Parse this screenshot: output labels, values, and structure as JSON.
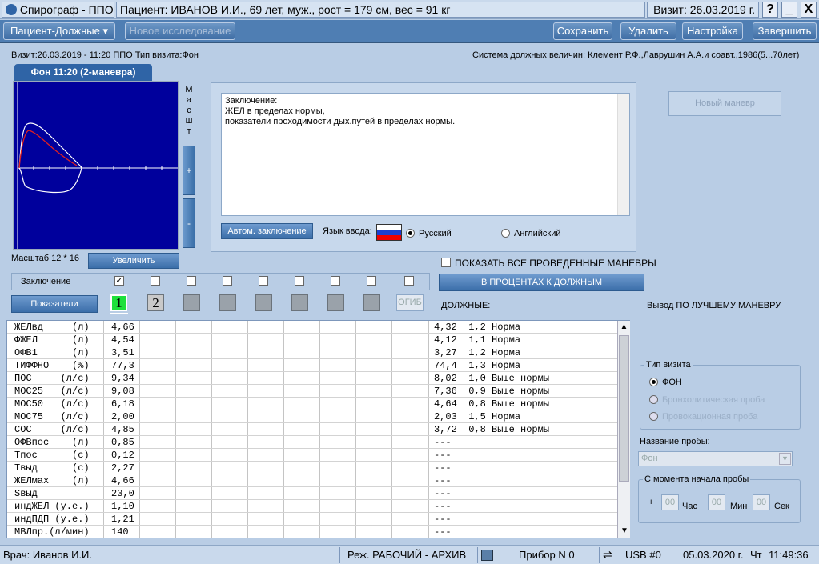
{
  "title_bar": {
    "app": "Спирограф - ППО",
    "patient": "Пациент: ИВАНОВ И.И., 69 лет, муж., рост = 179 см, вес = 91 кг",
    "visit": "Визит: 26.03.2019 г.",
    "help": "?",
    "minimize": "_",
    "close": "X"
  },
  "toolbar": {
    "dropdown": "Пациент-Должные",
    "new_study": "Новое исследование",
    "save": "Сохранить",
    "delete": "Удалить",
    "settings": "Настройка",
    "finish": "Завершить"
  },
  "visit_info": "Визит:26.03.2019 - 11:20 ППО Тип визита:Фон",
  "norm_system": "Система должных величин: Клемент Р.Ф.,Лаврушин А.А.и соавт.,1986(5...70лет)",
  "tab": "Фон 11:20 (2-маневра)",
  "scale_vertical": [
    "М",
    "а",
    "с",
    "ш",
    "т"
  ],
  "zoom_in": "+",
  "zoom_out": "-",
  "scale_label": "Масштаб 12 * 16",
  "enlarge_btn": "Увеличить",
  "conclusion_text": [
    "Заключение:",
    "ЖЕЛ в пределах нормы,",
    "показатели проходимости дых.путей в пределах нормы."
  ],
  "auto_conclusion_btn": "Автом. заключение",
  "input_lang_label": "Язык ввода:",
  "lang_ru": "Русский",
  "lang_en": "Английский",
  "new_maneuver_btn": "Новый маневр",
  "show_all_label": "ПОКАЗАТЬ ВСЕ ПРОВЕДЕННЫЕ МАНЕВРЫ",
  "percent_btn": "В ПРОЦЕНТАХ К ДОЛЖНЫМ",
  "conclusion_row_label": "Заключение",
  "indicators_btn": "Показатели",
  "maneuver_1": "1",
  "maneuver_2": "2",
  "ogib_btn": "ОГИБ",
  "due_label": "ДОЛЖНЫЕ:",
  "best_maneuver": "Вывод ПО ЛУЧШЕМУ МАНЕВРУ",
  "table_rows": [
    [
      "ЖЕЛвд     (л)",
      "4,66",
      "4,32  1,2 Норма"
    ],
    [
      "ФЖЕЛ      (л)",
      "4,54",
      "4,12  1,1 Норма"
    ],
    [
      "ОФВ1      (л)",
      "3,51",
      "3,27  1,2 Норма"
    ],
    [
      "ТИФФНО    (%)",
      "77,3",
      "74,4  1,3 Норма"
    ],
    [
      "ПОС     (л/с)",
      "9,34",
      "8,02  1,0 Выше нормы"
    ],
    [
      "МОС25   (л/с)",
      "9,08",
      "7,36  0,9 Выше нормы"
    ],
    [
      "МОС50   (л/с)",
      "6,18",
      "4,64  0,8 Выше нормы"
    ],
    [
      "МОС75   (л/с)",
      "2,00",
      "2,03  1,5 Норма"
    ],
    [
      "СОС     (л/с)",
      "4,85",
      "3,72  0,8 Выше нормы"
    ],
    [
      "ОФВпос    (л)",
      "0,85",
      "---"
    ],
    [
      "Tпос      (с)",
      "0,12",
      "---"
    ],
    [
      "Tвыд      (с)",
      "2,27",
      "---"
    ],
    [
      "ЖЕЛмах    (л)",
      "4,66",
      "---"
    ],
    [
      "Sвыд",
      "23,0",
      "---"
    ],
    [
      "индЖЕЛ (у.е.)",
      "1,10",
      "---"
    ],
    [
      "индПДП (у.е.)",
      "1,21",
      "---"
    ],
    [
      "МВЛпр.(л/мин)",
      "140",
      "---"
    ]
  ],
  "visit_type": {
    "title": "Тип визита",
    "opt1": "ФОН",
    "opt2": "Бронхолитическая проба",
    "opt3": "Провокационная проба"
  },
  "test_name_label": "Название пробы:",
  "test_name_value": "Фон",
  "since_start": {
    "title": "С момента начала пробы",
    "plus": "+",
    "h": "00",
    "h_lbl": "Час",
    "m": "00",
    "m_lbl": "Мин",
    "s": "00",
    "s_lbl": "Сек"
  },
  "status": {
    "doctor": "Врач: Иванов И.И.",
    "mode": "Реж. РАБОЧИЙ - АРХИВ",
    "device": "Прибор N 0",
    "usb": "USB #0",
    "date": "05.03.2020 г.",
    "dow": "Чт",
    "time": "11:49:36"
  }
}
